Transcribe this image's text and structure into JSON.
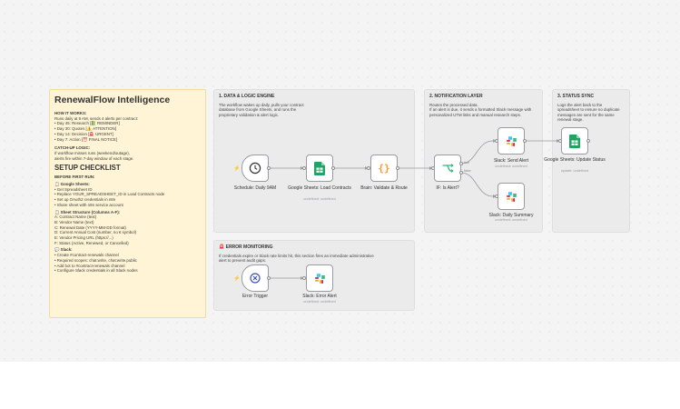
{
  "colors": {
    "canvas": "#f4f4f5",
    "note_bg": "#fff5d6",
    "sheets_green": "#1fa463",
    "router_green": "#36b37e",
    "code_orange": "#ff9b26",
    "error_blue": "#3f51b5",
    "trigger_bolt": "#ff6d3a"
  },
  "note": {
    "title": "RenewalFlow Intelligence",
    "how_heading": "HOW IT WORKS:",
    "how_lines": [
      "Runs daily at 9 AM, sends 4 alerts per contract:",
      "• Day 45: Research [📗 REMINDER]",
      "• Day 30: Quotes [⚠️ ATTENTION]",
      "• Day 14: Decision [🚨 URGENT]",
      "• Day 7: Action [⏰ FINAL NOTICE]"
    ],
    "catch_heading": "CATCH-UP LOGIC:",
    "catch_lines": [
      "If workflow misses runs (weekend/outage),",
      "alerts fire within 7-day window of each stage."
    ],
    "setup_title": "SETUP CHECKLIST",
    "before_heading": "BEFORE FIRST RUN:",
    "sheets_heading": "📋 Google Sheets:",
    "sheets_lines": [
      "• Get Spreadsheet ID",
      "• Replace YOUR_SPREADSHEET_ID in Load Contracts node",
      "• Set up OAuth2 credentials in n8n",
      "• Share sheet with n8n service account"
    ],
    "structure_heading": "📋 Sheet Structure (Columns A-F):",
    "structure_lines": [
      "A: Contract Name (text)",
      "B: Vendor Name (text)",
      "C: Renewal Date (YYYY-MM-DD format)",
      "D: Current Annual Cost (number, no € symbol)",
      "E: Vendor Pricing URL (https://...)",
      "F: Status (Active, Renewed, or Cancelled)"
    ],
    "slack_heading": "💬 Slack:",
    "slack_lines": [
      "• Create #contract-renewals channel",
      "• Required scopes: chat:write, chat:write.public",
      "• Add bot to #contract-renewals channel",
      "• Configure Slack credentials in all Slack nodes"
    ]
  },
  "sections": {
    "data": {
      "title": "1. DATA & LOGIC ENGINE",
      "desc": [
        "The workflow wakes up daily, pulls your contract",
        "database from Google Sheets, and runs the",
        "proprietary validation & alert logic."
      ]
    },
    "notify": {
      "title": "2. NOTIFICATION LAYER",
      "desc": [
        "Routes the processed data.",
        "If an alert is due, it sends a formatted Slack message with",
        "personalized UTM links and manual research steps."
      ]
    },
    "status": {
      "title": "3. STATUS SYNC",
      "desc": [
        "Logs the alert back to the",
        "spreadsheet to ensure no duplicate",
        "messages are sent for the same",
        "renewal stage."
      ]
    },
    "error": {
      "title": "🚨 ERROR MONITORING",
      "desc": [
        "If credentials expire or Slack rate limits hit, this section fires an immediate administrative",
        "alert to prevent audit gaps."
      ]
    }
  },
  "nodes": {
    "schedule": {
      "label": "Schedule: Daily 9AM"
    },
    "load": {
      "label": "Google Sheets: Load Contracts",
      "sub": "undefined: undefined"
    },
    "brain": {
      "label": "Brain: Validate & Route"
    },
    "ifnode": {
      "label": "IF: Is Alert?",
      "true_label": "true",
      "false_label": "false"
    },
    "send": {
      "label": "Slack: Send Alert",
      "sub": "undefined: undefined"
    },
    "summary": {
      "label": "Slack: Daily Summary",
      "sub": "undefined: undefined"
    },
    "update": {
      "label": "Google Sheets: Update Status",
      "sub": "update: undefined"
    },
    "errtrig": {
      "label": "Error Trigger"
    },
    "erralert": {
      "label": "Slack: Error Alert",
      "sub": "undefined: undefined"
    }
  }
}
